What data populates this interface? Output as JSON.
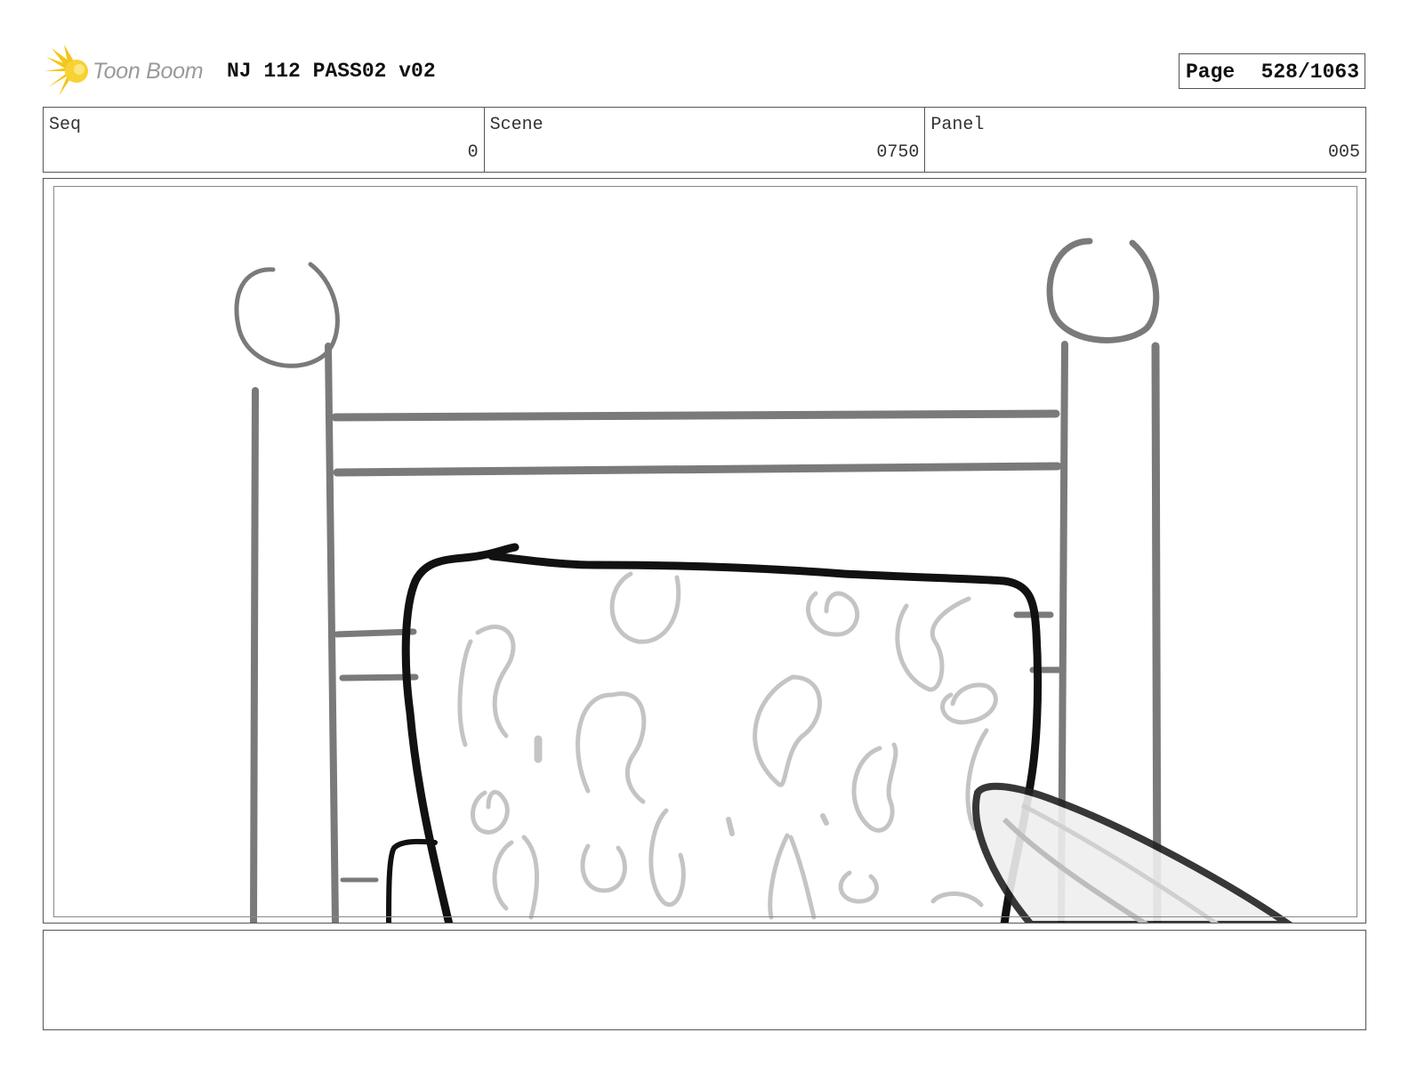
{
  "header": {
    "logo_text": "Toon Boom",
    "title": "NJ 112 PASS02 v02",
    "page_label": "Page",
    "page_value": "528/1063"
  },
  "info": {
    "seq_label": "Seq",
    "seq_value": "0",
    "scene_label": "Scene",
    "scene_value": "0750",
    "panel_label": "Panel",
    "panel_value": "005"
  },
  "notes": {
    "text": ""
  },
  "colors": {
    "logo_accent": "#f5c518",
    "sketch_gray": "#7a7a7a",
    "sketch_light": "#c4c4c4",
    "ink": "#111111"
  }
}
